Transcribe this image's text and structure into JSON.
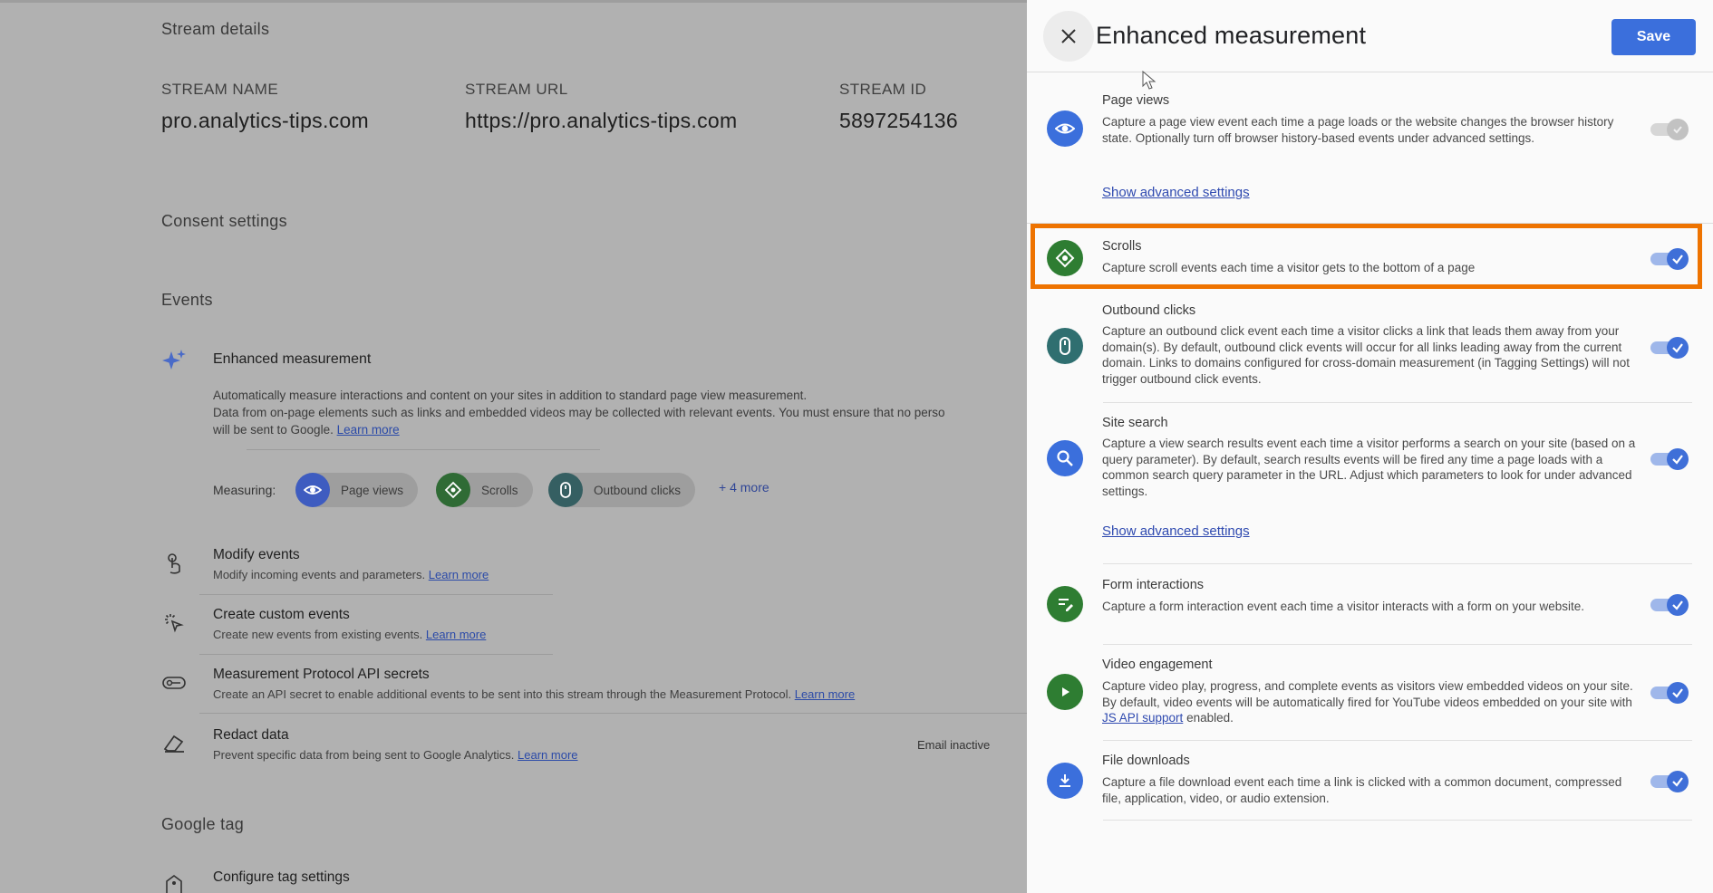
{
  "background": {
    "stream_details_heading": "Stream details",
    "columns": [
      {
        "label": "STREAM NAME",
        "value": "pro.analytics-tips.com"
      },
      {
        "label": "STREAM URL",
        "value": "https://pro.analytics-tips.com"
      },
      {
        "label": "STREAM ID",
        "value": "5897254136"
      }
    ],
    "consent_heading": "Consent settings",
    "events_heading": "Events",
    "enhanced": {
      "title": "Enhanced measurement",
      "desc_line1": "Automatically measure interactions and content on your sites in addition to standard page view measurement.",
      "desc_line2": "Data from on-page elements such as links and embedded videos may be collected with relevant events. You must ensure that no perso",
      "desc_line3_prefix": "will be sent to Google.",
      "learn_more": "Learn more",
      "measuring_label": "Measuring:",
      "chips": [
        "Page views",
        "Scrolls",
        "Outbound clicks"
      ],
      "more": "+ 4 more"
    },
    "rows": [
      {
        "title": "Modify events",
        "subtitle": "Modify incoming events and parameters.",
        "link": "Learn more"
      },
      {
        "title": "Create custom events",
        "subtitle": "Create new events from existing events.",
        "link": "Learn more"
      },
      {
        "title": "Measurement Protocol API secrets",
        "subtitle": "Create an API secret to enable additional events to be sent into this stream through the Measurement Protocol.",
        "link": "Learn more"
      },
      {
        "title": "Redact data",
        "subtitle": "Prevent specific data from being sent to Google Analytics.",
        "link": "Learn more"
      }
    ],
    "email_inactive": "Email inactive",
    "google_tag_heading": "Google tag",
    "configure_tag": "Configure tag settings"
  },
  "panel": {
    "title": "Enhanced measurement",
    "save_label": "Save",
    "items": [
      {
        "title": "Page views",
        "desc": "Capture a page view event each time a page loads or the website changes the browser history state. Optionally turn off browser history-based events under advanced settings.",
        "advanced": "Show advanced settings",
        "enabled": true,
        "toggle_disabled": true,
        "icon": "eye-icon",
        "color": "#3b6fdc"
      },
      {
        "title": "Scrolls",
        "desc": "Capture scroll events each time a visitor gets to the bottom of a page",
        "enabled": true,
        "icon": "scroll-icon",
        "color": "#2e7d32"
      },
      {
        "title": "Outbound clicks",
        "desc": "Capture an outbound click event each time a visitor clicks a link that leads them away from your domain(s). By default, outbound click events will occur for all links leading away from the current domain. Links to domains configured for cross-domain measurement (in Tagging Settings) will not trigger outbound click events.",
        "enabled": true,
        "icon": "mouse-icon",
        "color": "#2f6f70"
      },
      {
        "title": "Site search",
        "desc": "Capture a view search results event each time a visitor performs a search on your site (based on a query parameter). By default, search results events will be fired any time a page loads with a common search query parameter in the URL. Adjust which parameters to look for under advanced settings.",
        "advanced": "Show advanced settings",
        "enabled": true,
        "icon": "search-icon",
        "color": "#3b6fdc"
      },
      {
        "title": "Form interactions",
        "desc": "Capture a form interaction event each time a visitor interacts with a form on your website.",
        "enabled": true,
        "icon": "form-icon",
        "color": "#2e7d32"
      },
      {
        "title": "Video engagement",
        "desc_prefix": "Capture video play, progress, and complete events as visitors view embedded videos on your site. By default, video events will be automatically fired for YouTube videos embedded on your site with",
        "desc_link": "JS API support",
        "desc_suffix": "enabled.",
        "enabled": true,
        "icon": "play-icon",
        "color": "#2e7d32"
      },
      {
        "title": "File downloads",
        "desc": "Capture a file download event each time a link is clicked with a common document, compressed file, application, video, or audio extension.",
        "enabled": true,
        "icon": "download-icon",
        "color": "#3b6fdc"
      }
    ]
  }
}
